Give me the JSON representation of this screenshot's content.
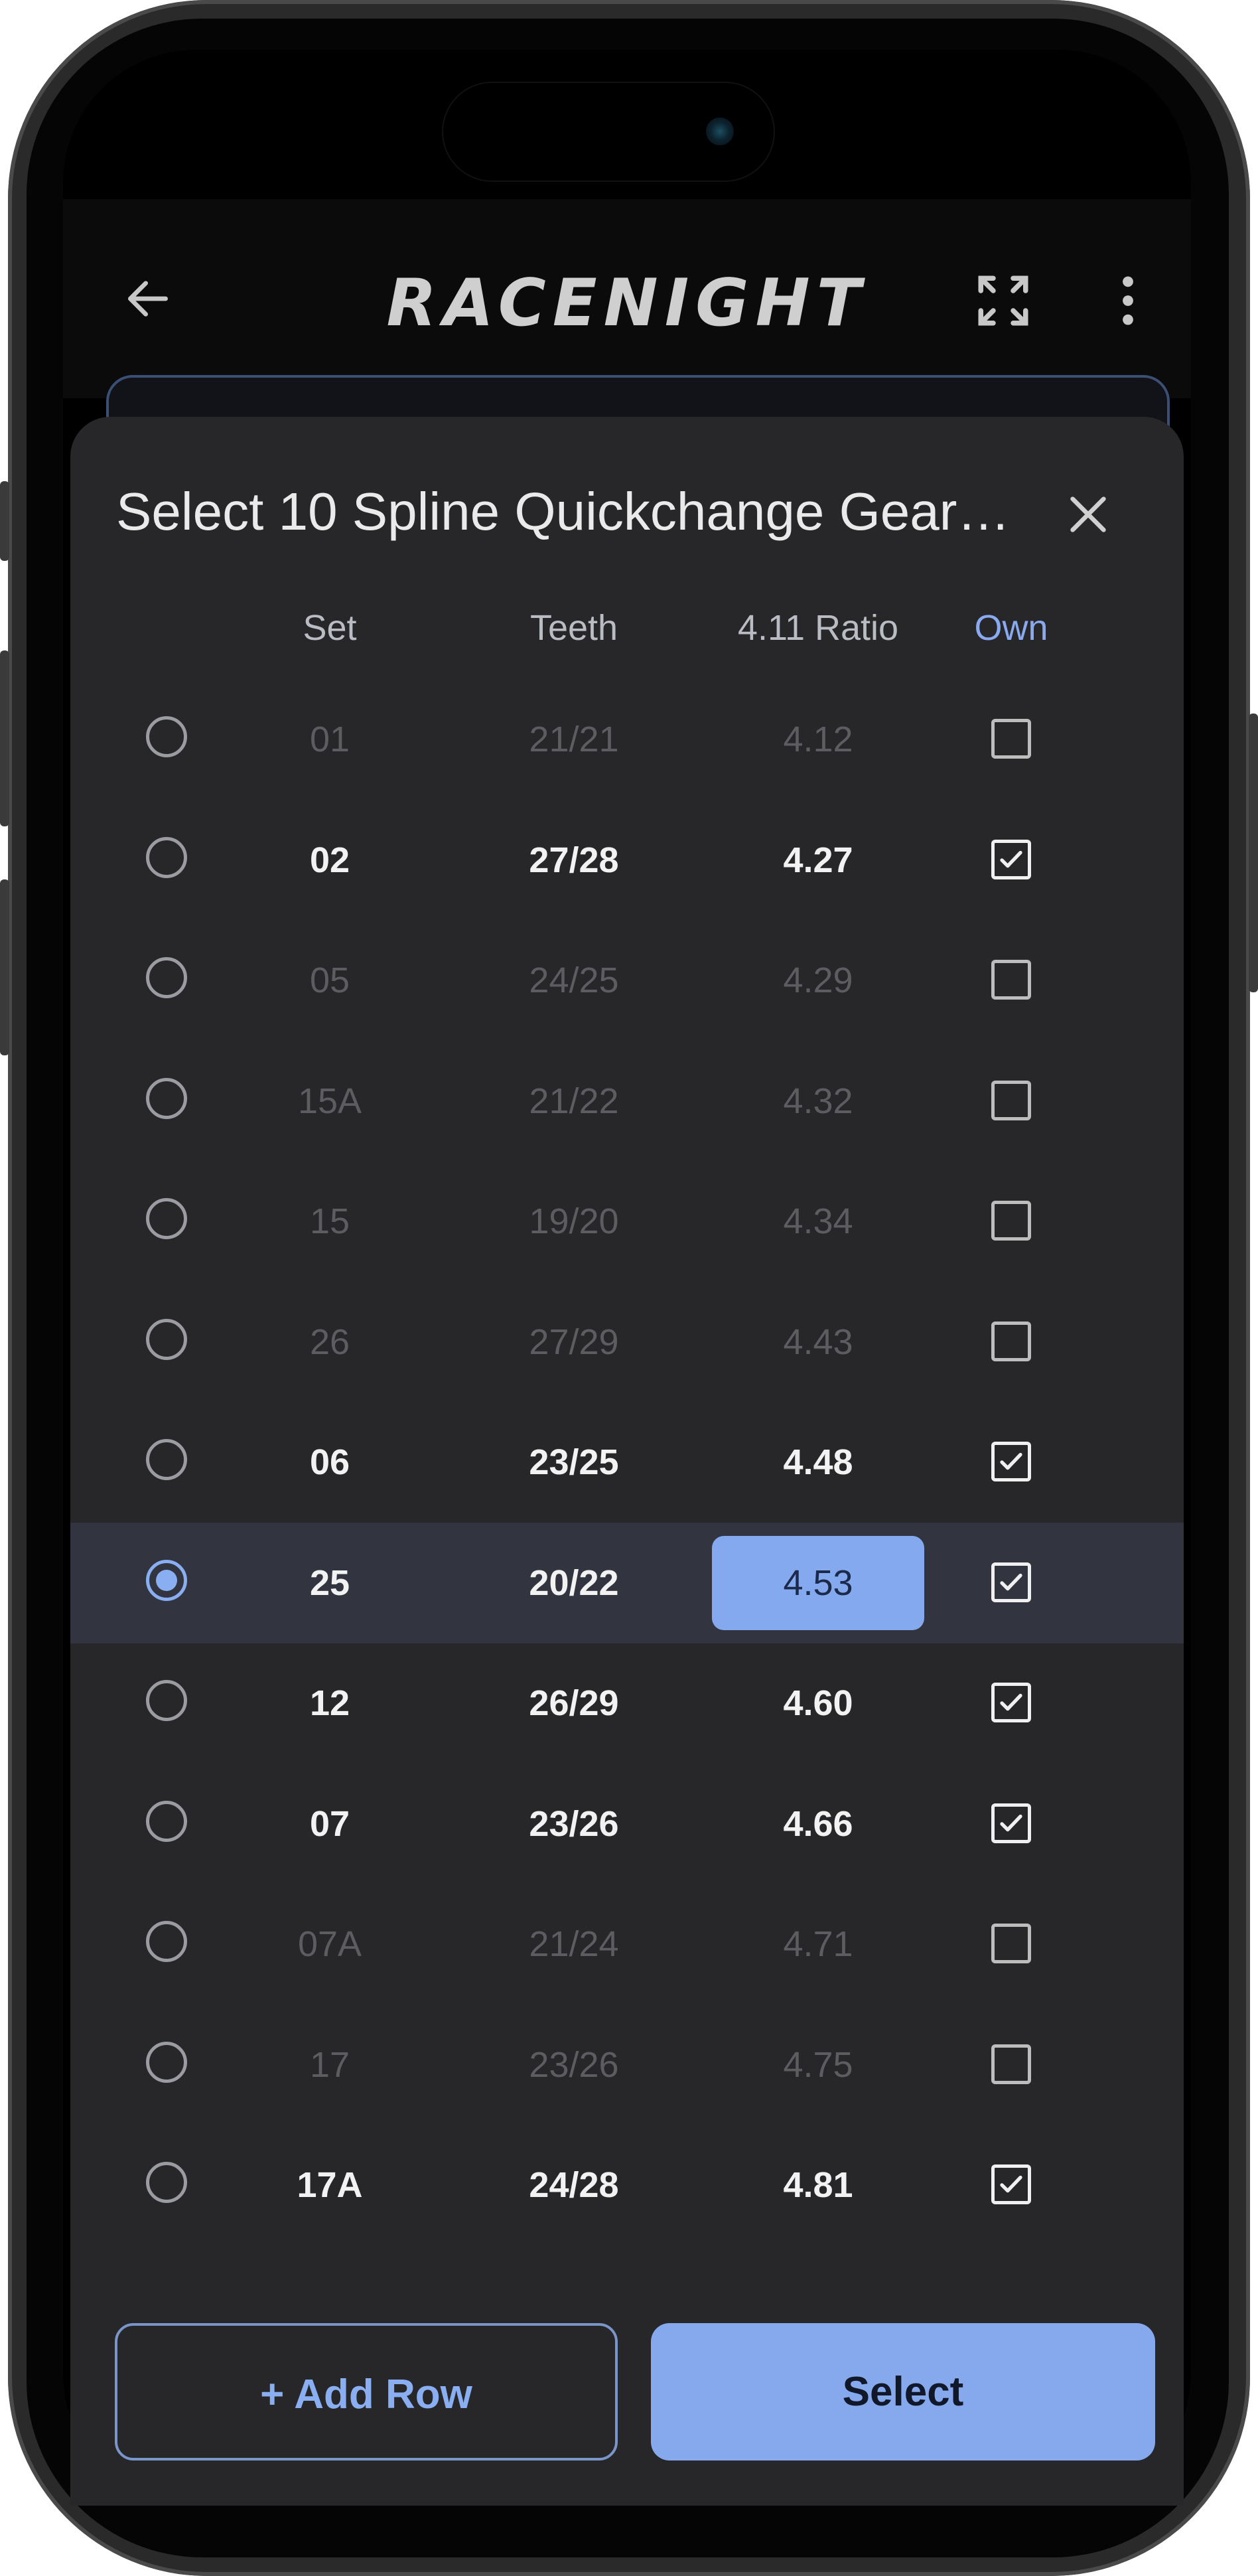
{
  "appbar": {
    "logo": "RACENIGHT"
  },
  "sheet": {
    "title": "Select 10 Spline Quickchange Gear…",
    "columns": {
      "set": "Set",
      "teeth": "Teeth",
      "ratio": "4.11 Ratio",
      "own": "Own"
    },
    "rows": [
      {
        "set": "01",
        "teeth": "21/21",
        "ratio": "4.12",
        "owned": false,
        "selected": false
      },
      {
        "set": "02",
        "teeth": "27/28",
        "ratio": "4.27",
        "owned": true,
        "selected": false
      },
      {
        "set": "05",
        "teeth": "24/25",
        "ratio": "4.29",
        "owned": false,
        "selected": false
      },
      {
        "set": "15A",
        "teeth": "21/22",
        "ratio": "4.32",
        "owned": false,
        "selected": false
      },
      {
        "set": "15",
        "teeth": "19/20",
        "ratio": "4.34",
        "owned": false,
        "selected": false
      },
      {
        "set": "26",
        "teeth": "27/29",
        "ratio": "4.43",
        "owned": false,
        "selected": false
      },
      {
        "set": "06",
        "teeth": "23/25",
        "ratio": "4.48",
        "owned": true,
        "selected": false
      },
      {
        "set": "25",
        "teeth": "20/22",
        "ratio": "4.53",
        "owned": true,
        "selected": true
      },
      {
        "set": "12",
        "teeth": "26/29",
        "ratio": "4.60",
        "owned": true,
        "selected": false
      },
      {
        "set": "07",
        "teeth": "23/26",
        "ratio": "4.66",
        "owned": true,
        "selected": false
      },
      {
        "set": "07A",
        "teeth": "21/24",
        "ratio": "4.71",
        "owned": false,
        "selected": false
      },
      {
        "set": "17",
        "teeth": "23/26",
        "ratio": "4.75",
        "owned": false,
        "selected": false
      },
      {
        "set": "17A",
        "teeth": "24/28",
        "ratio": "4.81",
        "owned": true,
        "selected": false
      }
    ],
    "add_row_label": "+ Add Row",
    "select_label": "Select"
  },
  "colors": {
    "accent": "#86a9ee",
    "sheet_bg": "#27272a",
    "selected_row": "#32353f"
  },
  "icons": [
    "back-arrow-icon",
    "fullscreen-icon",
    "more-vert-icon",
    "close-icon",
    "radio-icon",
    "checkbox-icon"
  ]
}
